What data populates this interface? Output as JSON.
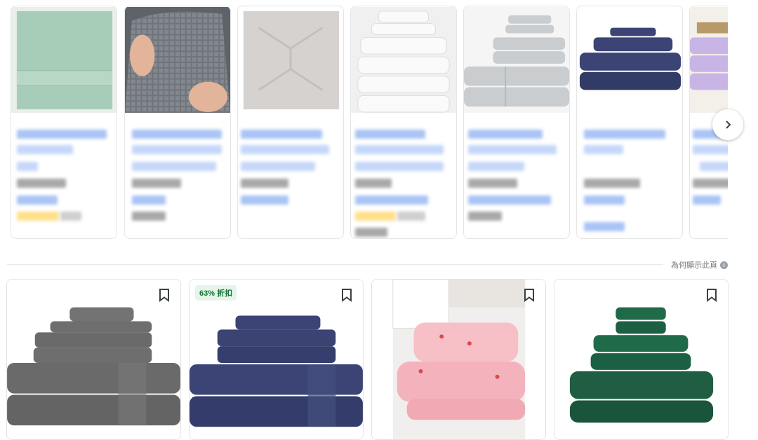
{
  "carousel": {
    "items": [
      {
        "id": "c1",
        "towel": "sage"
      },
      {
        "id": "c2",
        "towel": "waffle-gray"
      },
      {
        "id": "c3",
        "towel": "greige"
      },
      {
        "id": "c4",
        "towel": "white-stack"
      },
      {
        "id": "c5",
        "towel": "lightgray-stack"
      },
      {
        "id": "c6",
        "towel": "navy-stack"
      },
      {
        "id": "c7",
        "towel": "lavender-stack"
      }
    ],
    "next_icon": "chevron-right-icon"
  },
  "why_text": "為何顯示此頁",
  "products": [
    {
      "id": "p1",
      "badge": "",
      "towel": "gray-stack",
      "bookmark_icon": "bookmark-icon"
    },
    {
      "id": "p2",
      "badge": "63% 折扣",
      "towel": "navy-stack",
      "bookmark_icon": "bookmark-icon"
    },
    {
      "id": "p3",
      "badge": "",
      "towel": "pink-strawberry",
      "bookmark_icon": "bookmark-icon"
    },
    {
      "id": "p4",
      "badge": "",
      "towel": "green-stack",
      "bookmark_icon": "bookmark-icon"
    }
  ],
  "colors": {
    "sage": "#a7cdb8",
    "waffle": "#6f747a",
    "greige": "#d6d2cf",
    "white": "#f5f5f5",
    "lightgray": "#c9cdcf",
    "navy": "#3b4474",
    "lavender": "#c9b4e6",
    "gray": "#6e6e6e",
    "pink": "#f7bfc6",
    "green": "#1f5e42",
    "badge_bg": "#e6f4ea",
    "badge_text": "#137333"
  }
}
